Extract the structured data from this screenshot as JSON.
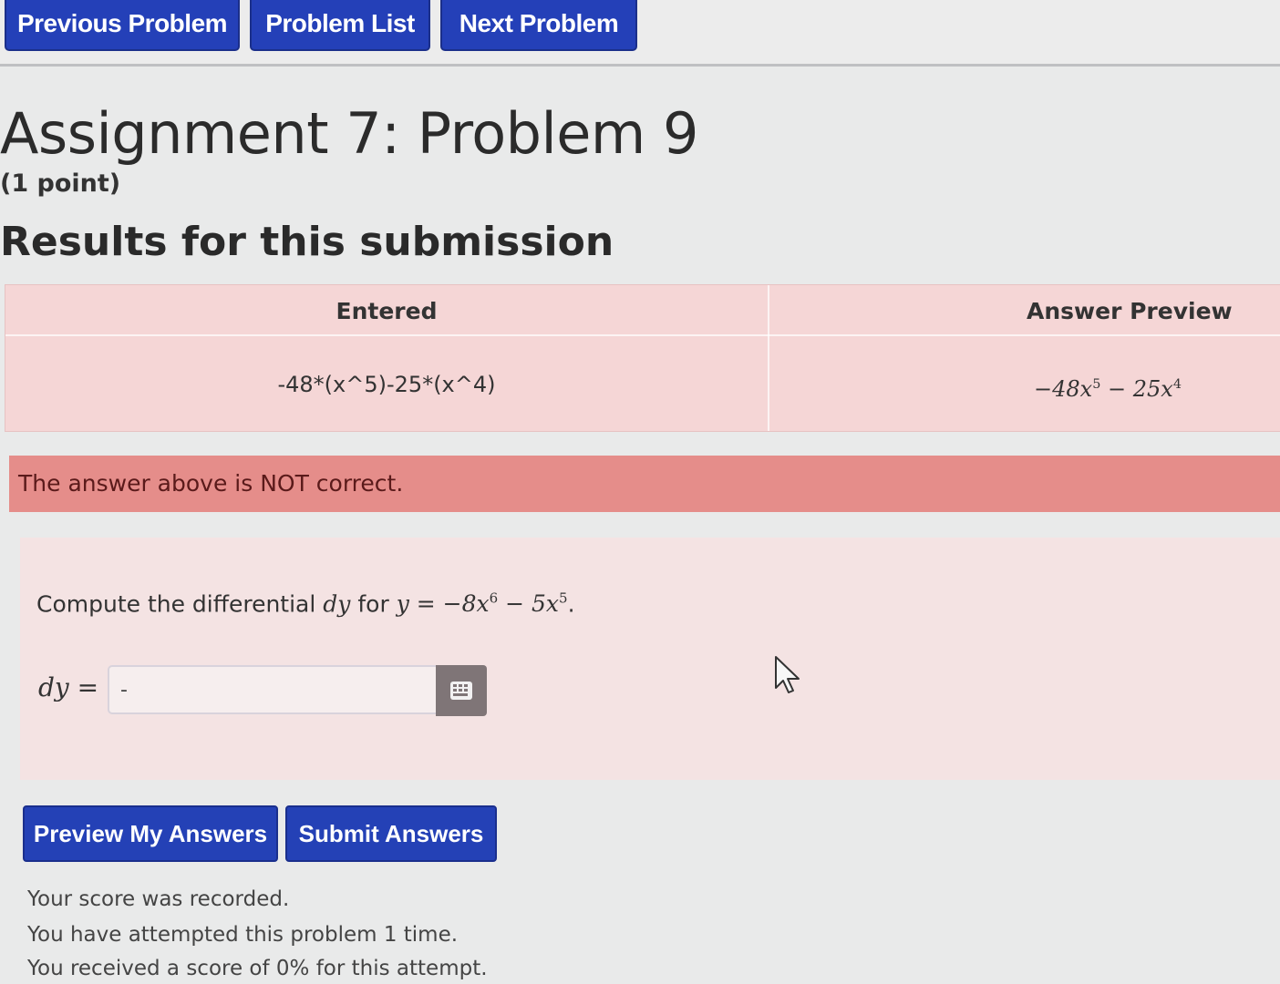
{
  "nav": {
    "previous": "Previous Problem",
    "list": "Problem List",
    "next": "Next Problem"
  },
  "problem": {
    "title": "Assignment 7: Problem 9",
    "points": "(1 point)"
  },
  "results": {
    "heading": "Results for this submission",
    "entered_header": "Entered",
    "preview_header": "Answer Preview",
    "entered_value": "-48*(x^5)-25*(x^4)",
    "preview_value": "−48x^5 − 25x^4"
  },
  "alert": {
    "message": "The answer above is NOT correct."
  },
  "question": {
    "prefix": "Compute the differential",
    "variable": "dy",
    "middle": "for",
    "equation": "y = −8x^6 − 5x^5",
    "answer_label": "dy =",
    "answer_value": "-"
  },
  "actions": {
    "preview": "Preview My Answers",
    "submit": "Submit Answers"
  },
  "score": {
    "line1": "Your score was recorded.",
    "line2": "You have attempted this problem 1 time.",
    "line3": "You received a score of 0% for this attempt."
  },
  "colors": {
    "button_blue": "#2440b8",
    "alert_red": "#e58d8a",
    "table_pink": "#f5d6d6"
  },
  "icons": {
    "keypad": "keypad-icon",
    "cursor": "mouse-pointer-icon"
  }
}
